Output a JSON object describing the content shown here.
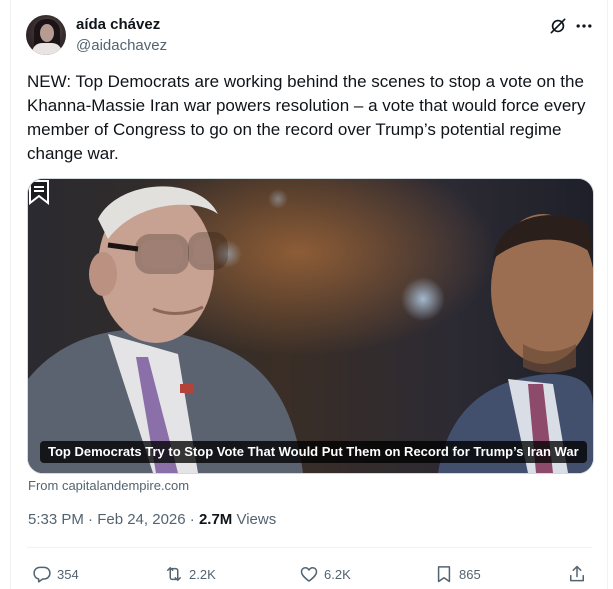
{
  "author": {
    "display_name": "aída chávez",
    "handle": "@aidachavez"
  },
  "icons": {
    "grok": "grok-icon",
    "more": "more-icon",
    "reply": "reply-icon",
    "retweet": "retweet-icon",
    "like": "like-icon",
    "bookmark": "bookmark-icon",
    "share": "share-icon"
  },
  "tweet": {
    "text": "NEW: Top Democrats are working behind the scenes to stop a vote on the Khanna-Massie Iran war powers resolution – a vote that would force every member of Congress to go on the record over Trump’s potential regime change war."
  },
  "card": {
    "caption": "Top Democrats Try to Stop Vote That Would Put Them on Record for Trump’s Iran War",
    "source": "From capitalandempire.com"
  },
  "meta": {
    "time_date": "5:33 PM · Feb 24, 2026 · ",
    "views_count": "2.7M",
    "views_label": " Views"
  },
  "actions": {
    "replies": "354",
    "retweets": "2.2K",
    "likes": "6.2K",
    "bookmarks": "865"
  },
  "colors": {
    "text_primary": "#0f1419",
    "text_secondary": "#536471",
    "divider": "#eff3f4"
  }
}
